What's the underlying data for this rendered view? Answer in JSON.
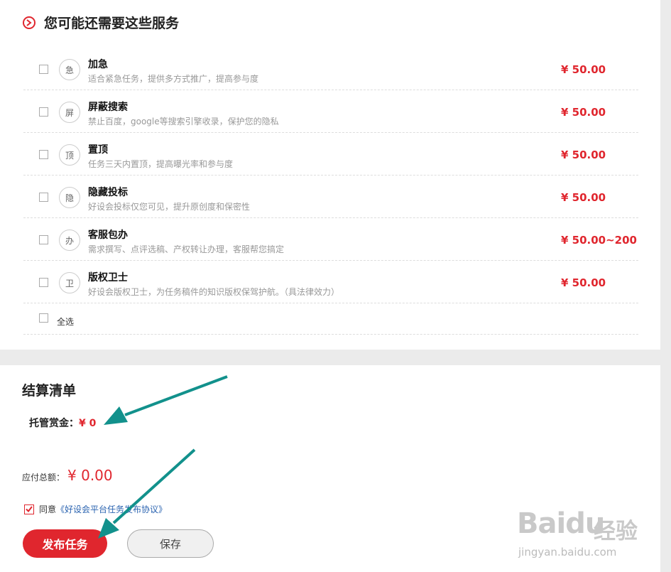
{
  "services": {
    "title": "您可能还需要这些服务",
    "items": [
      {
        "badge": "急",
        "name": "加急",
        "desc": "适合紧急任务，提供多方式推广，提高参与度",
        "price": "¥ 50.00"
      },
      {
        "badge": "屏",
        "name": "屏蔽搜索",
        "desc": "禁止百度，google等搜索引擎收录，保护您的隐私",
        "price": "¥ 50.00"
      },
      {
        "badge": "顶",
        "name": "置顶",
        "desc": "任务三天内置顶，提高曝光率和参与度",
        "price": "¥ 50.00"
      },
      {
        "badge": "隐",
        "name": "隐藏投标",
        "desc": "好设会投标仅您可见，提升原创度和保密性",
        "price": "¥ 50.00"
      },
      {
        "badge": "办",
        "name": "客服包办",
        "desc": "需求撰写、点评选稿、产权转让办理，客服帮您搞定",
        "price": "¥ 50.00~200"
      },
      {
        "badge": "卫",
        "name": "版权卫士",
        "desc": "好设会版权卫士，为任务稿件的知识版权保驾护航。（具法律效力）",
        "price": "¥ 50.00"
      }
    ],
    "select_all_label": "全选"
  },
  "checkout": {
    "title": "结算清单",
    "escrow_label": "托管赏金：",
    "escrow_amount": "¥ 0",
    "payable_label": "应付总额：",
    "payable_amount": "¥ 0.00",
    "agree_prefix": "同意",
    "agree_link": "《好设会平台任务发布协议》",
    "agree_checked": true,
    "publish_label": "发布任务",
    "save_label": "保存"
  },
  "watermark": {
    "logo": "Baidu",
    "cn": "经验",
    "url": "jingyan.baidu.com"
  },
  "colors": {
    "accent": "#e0262e",
    "annotation_arrow": "#12918c",
    "link": "#2a63b0"
  }
}
